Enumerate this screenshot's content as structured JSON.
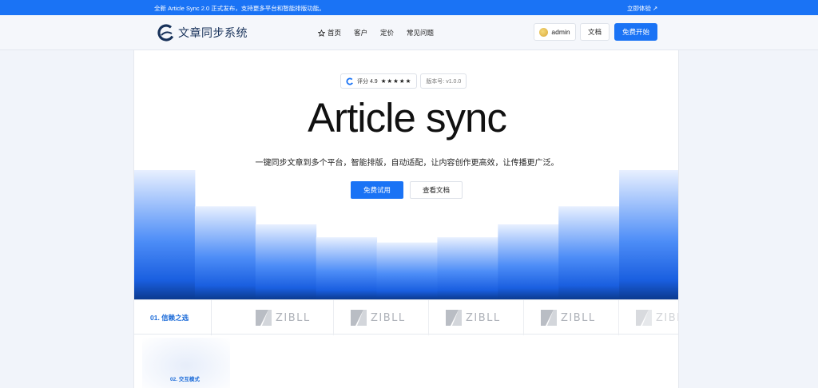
{
  "announcement": {
    "message": "全新 Article Sync 2.0 正式发布，支持更多平台和智能排版功能。",
    "cta": "立即体验 ↗"
  },
  "nav": {
    "logo_text": "文章同步系统",
    "menu": [
      {
        "label": "首页",
        "icon": "star-icon"
      },
      {
        "label": "客户"
      },
      {
        "label": "定价"
      },
      {
        "label": "常见问题"
      }
    ],
    "user_label": "admin",
    "docs_label": "文档",
    "start_label": "免费开始"
  },
  "hero": {
    "rating_label": "评分 4.9",
    "stars": "★★★★★",
    "version_label": "版本号: v1.0.0",
    "title": "Article sync",
    "subtitle": "一键同步文章到多个平台，智能排版，自动适配，让内容创作更高效，让传播更广泛。",
    "primary_button": "免费试用",
    "secondary_button": "查看文档",
    "bar_levels": [
      1.0,
      0.72,
      0.58,
      0.48,
      0.44,
      0.48,
      0.58,
      0.72,
      1.0
    ]
  },
  "trust": {
    "label": "01. 信赖之选",
    "logos": [
      "ZIBLL",
      "ZIBLL",
      "ZIBLL",
      "ZIBLL",
      "ZIBLL"
    ]
  },
  "section2": {
    "label": "02. 交互模式"
  },
  "colors": {
    "accent": "#1a73f5",
    "bar_bottom": "#0b3a8f",
    "bar_top": "#e8f0ff"
  }
}
